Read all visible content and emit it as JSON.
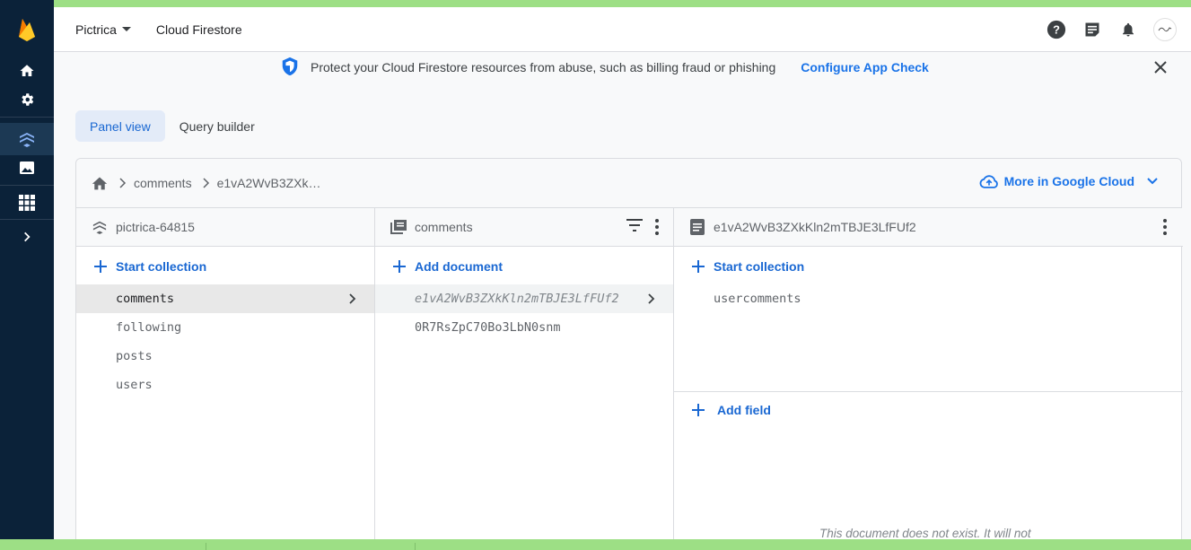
{
  "topbar": {
    "project_name": "Pictrica",
    "product_name": "Cloud Firestore"
  },
  "banner": {
    "message": "Protect your Cloud Firestore resources from abuse, such as billing fraud or phishing",
    "link_label": "Configure App Check"
  },
  "tabs": [
    {
      "label": "Panel view"
    },
    {
      "label": "Query builder"
    }
  ],
  "breadcrumb": {
    "items": [
      "comments",
      "e1vA2WvB3ZXk…"
    ],
    "more_label": "More in Google Cloud"
  },
  "columns": {
    "root": {
      "title": "pictrica-64815",
      "add_label": "Start collection",
      "items": [
        "comments",
        "following",
        "posts",
        "users"
      ]
    },
    "collection": {
      "title": "comments",
      "add_label": "Add document",
      "items": [
        "e1vA2WvB3ZXkKln2mTBJE3LfFUf2",
        "0R7RsZpC70Bo3LbN0snm"
      ]
    },
    "document": {
      "title": "e1vA2WvB3ZXkKln2mTBJE3LfFUf2",
      "add_collection_label": "Start collection",
      "subcollections": [
        "usercomments"
      ],
      "add_field_label": "Add field",
      "note": "This document does not exist. It will not"
    }
  },
  "colors": {
    "rail_bg": "#0b2239",
    "accent": "#1a73e8",
    "tab_active_bg": "#e3ebf8",
    "stripe": "#9ddf85"
  }
}
